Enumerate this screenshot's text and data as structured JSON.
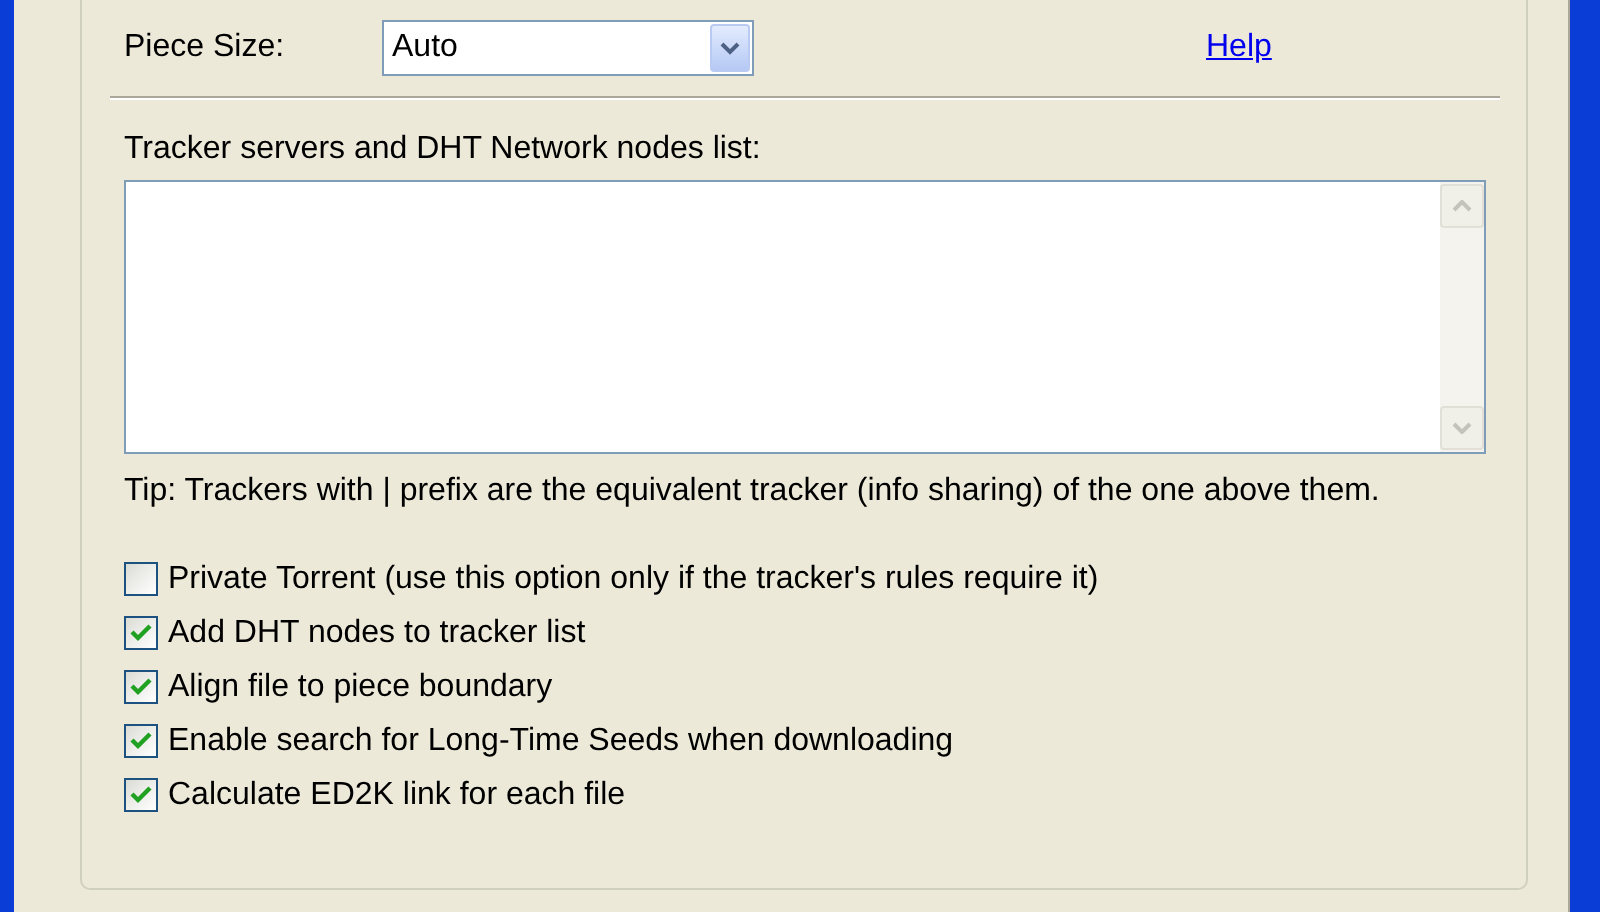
{
  "piece_size": {
    "label": "Piece Size:",
    "value": "Auto"
  },
  "help_link": "Help",
  "trackers": {
    "label": "Tracker servers and DHT Network nodes list:"
  },
  "tip": "Tip: Trackers with | prefix are the equivalent tracker (info sharing) of the one above them.",
  "options": [
    {
      "label": "Private Torrent (use this option only if the tracker's rules require it)",
      "checked": false
    },
    {
      "label": "Add DHT nodes to tracker list",
      "checked": true
    },
    {
      "label": "Align file to piece boundary",
      "checked": true
    },
    {
      "label": "Enable search for Long-Time Seeds when downloading",
      "checked": true
    },
    {
      "label": "Calculate ED2K link for each file",
      "checked": true
    }
  ]
}
